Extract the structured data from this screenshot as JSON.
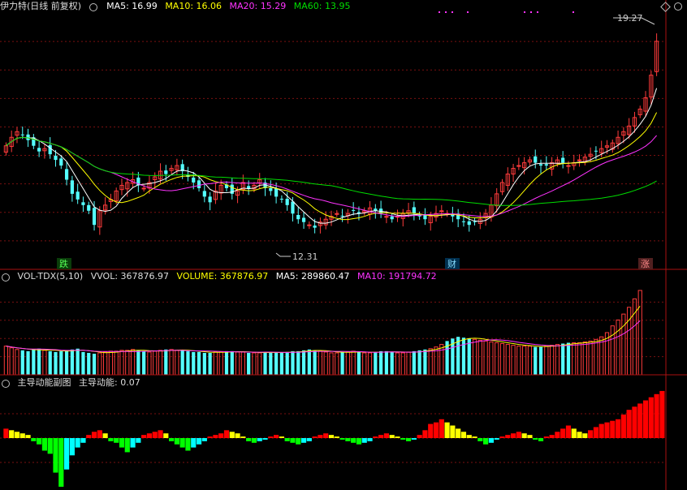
{
  "colors": {
    "bg": "#000000",
    "up": "#ff3b3b",
    "down": "#54ffff",
    "grid": "#7a1010",
    "ma5": "#ffffff",
    "ma10": "#ffff00",
    "ma20": "#ff33ff",
    "ma60": "#00dd00",
    "red_bar": "#ff0000",
    "yellow_bar": "#ffff00",
    "green_bar": "#00ff00",
    "cyan_bar": "#00ffff"
  },
  "main_panel": {
    "title": "伊力特(日线 前复权)",
    "ma5_label": "MA5: 16.99",
    "ma10_label": "MA10: 16.06",
    "ma20_label": "MA20: 15.29",
    "ma60_label": "MA60: 13.95",
    "high_marker": "19.27",
    "low_marker": "12.31",
    "event_left": "跌",
    "event_mid": "财",
    "event_right": "涨"
  },
  "volume_panel": {
    "title": "VOL-TDX(5,10)",
    "vvol_label": "VVOL: 367876.97",
    "volume_label": "VOLUME: 367876.97",
    "ma5_label": "MA5: 289860.47",
    "ma10_label": "MA10: 191794.72"
  },
  "force_panel": {
    "title": "主导动能副图",
    "value_label": "主导动能: 0.07"
  },
  "chart_data": {
    "type": "candlestick",
    "price_range": [
      11.5,
      19.6
    ],
    "closes": [
      15.3,
      15.6,
      15.8,
      15.7,
      15.5,
      15.3,
      15.1,
      15.2,
      15.0,
      14.8,
      14.6,
      14.1,
      13.6,
      13.4,
      13.2,
      13.0,
      12.5,
      13.0,
      13.2,
      13.4,
      13.7,
      13.9,
      14.0,
      14.1,
      13.9,
      13.8,
      14.0,
      14.2,
      14.4,
      14.3,
      14.5,
      14.6,
      14.4,
      14.2,
      14.0,
      13.8,
      13.5,
      13.3,
      13.7,
      13.9,
      13.8,
      13.6,
      13.7,
      14.0,
      13.8,
      13.9,
      14.1,
      13.8,
      13.7,
      13.5,
      13.4,
      13.2,
      12.9,
      12.7,
      12.6,
      12.5,
      12.4,
      12.6,
      12.7,
      12.8,
      12.9,
      12.8,
      12.9,
      13.0,
      12.9,
      13.0,
      13.1,
      13.0,
      12.9,
      12.8,
      12.7,
      12.8,
      12.9,
      13.0,
      12.9,
      12.8,
      12.7,
      12.8,
      12.9,
      13.0,
      12.9,
      12.8,
      12.7,
      12.6,
      12.5,
      12.6,
      12.7,
      12.9,
      13.2,
      13.6,
      14.0,
      14.3,
      14.5,
      14.6,
      14.7,
      14.8,
      14.7,
      14.6,
      14.6,
      14.7,
      14.8,
      14.7,
      14.6,
      14.7,
      14.8,
      14.9,
      15.0,
      15.1,
      15.2,
      15.3,
      15.4,
      15.6,
      15.8,
      16.0,
      16.3,
      16.6,
      17.0,
      17.8,
      19.0
    ],
    "volume": [
      34,
      32,
      30,
      29,
      28,
      30,
      31,
      29,
      28,
      27,
      28,
      29,
      30,
      31,
      27,
      26,
      25,
      26,
      27,
      28,
      28,
      29,
      29,
      30,
      29,
      28,
      27,
      28,
      29,
      30,
      30,
      29,
      29,
      28,
      27,
      27,
      26,
      26,
      27,
      27,
      28,
      28,
      27,
      27,
      26,
      26,
      26,
      27,
      27,
      26,
      26,
      27,
      28,
      28,
      29,
      30,
      29,
      28,
      27,
      26,
      26,
      27,
      27,
      28,
      27,
      26,
      26,
      27,
      28,
      28,
      27,
      26,
      26,
      27,
      28,
      29,
      30,
      31,
      33,
      36,
      40,
      43,
      45,
      44,
      43,
      42,
      41,
      40,
      39,
      38,
      37,
      36,
      35,
      34,
      34,
      34,
      33,
      33,
      34,
      35,
      36,
      37,
      38,
      38,
      38,
      39,
      40,
      42,
      45,
      50,
      58,
      65,
      72,
      80,
      90,
      100
    ],
    "force": [
      0.6,
      0.5,
      0.4,
      0.3,
      0.2,
      -0.2,
      -0.4,
      -0.8,
      -1.0,
      -2.2,
      -3.1,
      -2.0,
      -1.1,
      -0.6,
      -0.3,
      0.2,
      0.4,
      0.5,
      0.3,
      -0.2,
      -0.3,
      -0.6,
      -0.9,
      -0.6,
      -0.3,
      0.2,
      0.3,
      0.4,
      0.5,
      0.3,
      -0.2,
      -0.4,
      -0.6,
      -0.8,
      -0.6,
      -0.4,
      -0.2,
      0.1,
      0.2,
      0.3,
      0.5,
      0.4,
      0.3,
      0.1,
      -0.2,
      -0.3,
      -0.2,
      -0.1,
      0.1,
      0.2,
      0.1,
      -0.2,
      -0.3,
      -0.4,
      -0.3,
      -0.2,
      0.1,
      0.2,
      0.3,
      0.2,
      0.1,
      -0.1,
      -0.2,
      -0.3,
      -0.4,
      -0.3,
      -0.2,
      0.1,
      0.2,
      0.3,
      0.2,
      0.1,
      -0.1,
      -0.2,
      -0.1,
      0.2,
      0.5,
      0.9,
      1.0,
      1.2,
      1.0,
      0.8,
      0.6,
      0.4,
      0.2,
      0.1,
      -0.2,
      -0.4,
      -0.3,
      -0.1,
      0.1,
      0.2,
      0.3,
      0.4,
      0.3,
      0.2,
      -0.1,
      -0.2,
      0.1,
      0.2,
      0.4,
      0.6,
      0.8,
      0.6,
      0.4,
      0.3,
      0.5,
      0.7,
      0.9,
      1.0,
      1.1,
      1.2,
      1.5,
      1.8,
      2.0,
      2.2,
      2.4,
      2.6,
      2.8,
      3.0
    ]
  }
}
